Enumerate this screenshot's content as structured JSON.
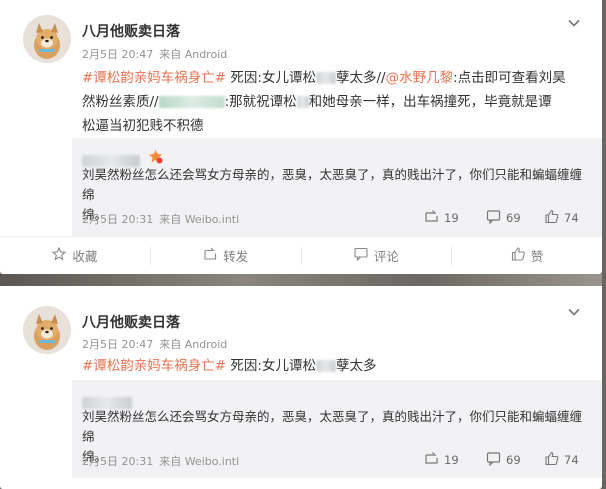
{
  "posts": [
    {
      "author": "八月他贩卖日落",
      "time": "2月5日 20:47",
      "source": "来自 Android",
      "line1_topic": "#谭松韵亲妈车祸身亡#",
      "line1_text_a": " 死因:女儿谭松",
      "line1_text_b": "孽太多//",
      "line1_mention": "@水野几黎",
      "line1_text_c": ":点击即可查看刘昊",
      "line2_text_a": "然粉丝素质//",
      "line2_mention_suffix": ":那就祝谭松",
      "line2_text_b": "和她母亲一样，出车祸撞死，毕竟就是谭",
      "line3_text": "松逼当初犯贱不积德",
      "comment": {
        "text_line1": "刘昊然粉丝怎么还会骂女方母亲的，恶臭，太恶臭了，真的贱出汁了，你们只能和蝙蝠缠缠绵",
        "text_line2": "绵。",
        "time": "2月5日 20:31",
        "source": "来自 Weibo.intl",
        "reposts": "19",
        "comments": "69",
        "likes": "74"
      },
      "actions": {
        "favorite": "收藏",
        "repost": "转发",
        "comment": "评论",
        "like": "赞"
      }
    },
    {
      "author": "八月他贩卖日落",
      "time": "2月5日 20:47",
      "source": "来自 Android",
      "line1_topic": "#谭松韵亲妈车祸身亡#",
      "line1_text_a": " 死因:女儿谭松",
      "line1_text_b": "孽太多",
      "comment": {
        "text_line1": "刘昊然粉丝怎么还会骂女方母亲的，恶臭，太恶臭了，真的贱出汁了，你们只能和蝙蝠缠缠绵",
        "text_line2": "绵。",
        "time": "2月5日 20:31",
        "source": "来自 Weibo.intl",
        "reposts": "19",
        "comments": "69",
        "likes": "74"
      }
    }
  ],
  "colors": {
    "link": "#eb7350",
    "meta": "#939393",
    "comment_bg": "#f2f2f5",
    "badge": "#f78b38"
  },
  "icons": [
    "chevron-down-icon",
    "repost-icon",
    "comment-icon",
    "like-icon",
    "star-icon",
    "vip-badge-icon"
  ]
}
